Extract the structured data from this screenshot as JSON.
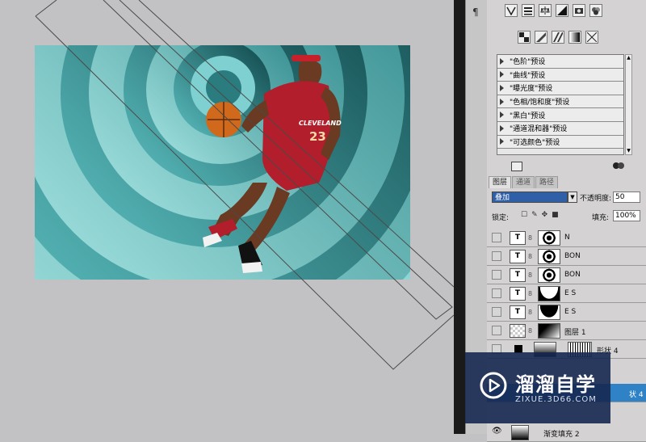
{
  "adjustments": {
    "presets": [
      "\"色阶\"预设",
      "\"曲线\"预设",
      "\"曝光度\"预设",
      "\"色相/饱和度\"预设",
      "\"黑白\"预设",
      "\"通道混和器\"预设",
      "\"可选颜色\"预设"
    ]
  },
  "layers_panel": {
    "tabs": [
      "图层",
      "通道",
      "路径"
    ],
    "blend_mode": "叠加",
    "opacity_label": "不透明度:",
    "opacity_value": "50",
    "lock_label": "锁定:",
    "fill_label": "填充:",
    "fill_value": "100%",
    "layers": [
      {
        "name": "N",
        "type": "text"
      },
      {
        "name": "BON",
        "type": "text"
      },
      {
        "name": "BON",
        "type": "text"
      },
      {
        "name": "E S",
        "type": "text"
      },
      {
        "name": "E S",
        "type": "text"
      },
      {
        "name": "图层 1",
        "type": "raster"
      },
      {
        "name": "形状 4",
        "type": "shape"
      },
      {
        "name": "状 4",
        "type": "shape-selected"
      },
      {
        "name": "渐变填充 2",
        "type": "gradient"
      }
    ]
  },
  "image": {
    "jersey_text": "CLEVELAND",
    "jersey_number": "23"
  },
  "watermark": {
    "title": "溜溜自学",
    "url": "ZIXUE.3D66.COM"
  },
  "colors": {
    "teal_light": "#9fe0e0",
    "teal_dark": "#0d4347",
    "selection_blue": "#2f5fa6",
    "watermark_bg": "#162850"
  }
}
